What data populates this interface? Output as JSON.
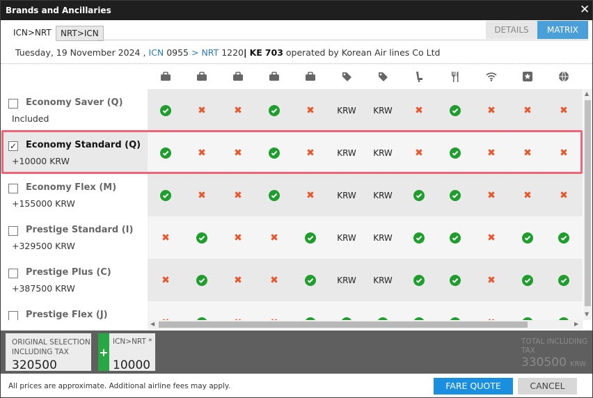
{
  "window": {
    "title": "Brands and Ancillaries",
    "close_glyph": "✕"
  },
  "route_tabs": [
    {
      "label": "ICN>NRT",
      "active": true
    },
    {
      "label": "NRT>ICN",
      "active": false
    }
  ],
  "view_tabs": {
    "details": "DETAILS",
    "matrix": "MATRIX"
  },
  "flight": {
    "date": "Tuesday, 19 November 2024 ,",
    "origin": "ICN",
    "dep_time": "0955",
    "arrow": ">",
    "dest": "NRT",
    "arr_time": "1220",
    "bar": "|",
    "carrier": "KE",
    "flight_no": "703",
    "operated": "operated by Korean Air lines Co Ltd"
  },
  "columns": [
    "bag-icon",
    "bag-icon",
    "bag-icon",
    "bag-icon",
    "bag-icon",
    "tag-icon",
    "tag-icon",
    "seat-icon",
    "meal-icon",
    "wifi-icon",
    "star-icon",
    "globe-icon"
  ],
  "brands": [
    {
      "name": "Economy Saver (Q)",
      "price": "Included",
      "checked": false,
      "selected": false,
      "cells": [
        "ok",
        "no",
        "no",
        "ok",
        "no",
        "KRW",
        "KRW",
        "no",
        "ok",
        "no",
        "no",
        "no"
      ]
    },
    {
      "name": "Economy Standard (Q)",
      "price": "+10000 KRW",
      "checked": true,
      "selected": true,
      "cells": [
        "ok",
        "no",
        "no",
        "ok",
        "no",
        "KRW",
        "KRW",
        "no",
        "ok",
        "no",
        "no",
        "no"
      ]
    },
    {
      "name": "Economy Flex (M)",
      "price": "+155000 KRW",
      "checked": false,
      "selected": false,
      "cells": [
        "ok",
        "no",
        "no",
        "ok",
        "no",
        "KRW",
        "KRW",
        "ok",
        "ok",
        "no",
        "no",
        "no"
      ]
    },
    {
      "name": "Prestige Standard (I)",
      "price": "+329500 KRW",
      "checked": false,
      "selected": false,
      "cells": [
        "no",
        "ok",
        "no",
        "no",
        "ok",
        "KRW",
        "KRW",
        "ok",
        "ok",
        "no",
        "ok",
        "ok"
      ]
    },
    {
      "name": "Prestige Plus (C)",
      "price": "+387500 KRW",
      "checked": false,
      "selected": false,
      "cells": [
        "no",
        "ok",
        "no",
        "no",
        "ok",
        "KRW",
        "KRW",
        "ok",
        "ok",
        "no",
        "ok",
        "ok"
      ]
    },
    {
      "name": "Prestige Flex (J)",
      "price": "",
      "checked": false,
      "selected": false,
      "cells": [
        "no",
        "ok",
        "no",
        "no",
        "ok",
        "ok",
        "ok",
        "ok",
        "ok",
        "no",
        "ok",
        "ok"
      ]
    }
  ],
  "footer": {
    "original_label": "ORIGINAL SELECTION INCLUDING TAX",
    "original_value": "320500",
    "plus": "+",
    "segment_label": "ICN>NRT *",
    "segment_value": "10000",
    "total_label": "TOTAL INCLUDING TAX",
    "total_value": "330500",
    "total_currency": "KRW"
  },
  "disclaimer": "All prices are approximate. Additional airline fees may apply.",
  "buttons": {
    "fare_quote": "FARE QUOTE",
    "cancel": "CANCEL"
  },
  "colors": {
    "accent": "#4a9fd8",
    "button": "#1a8fe0",
    "ok": "#1f9e2d",
    "no": "#e8562a",
    "highlight": "#f06478"
  }
}
